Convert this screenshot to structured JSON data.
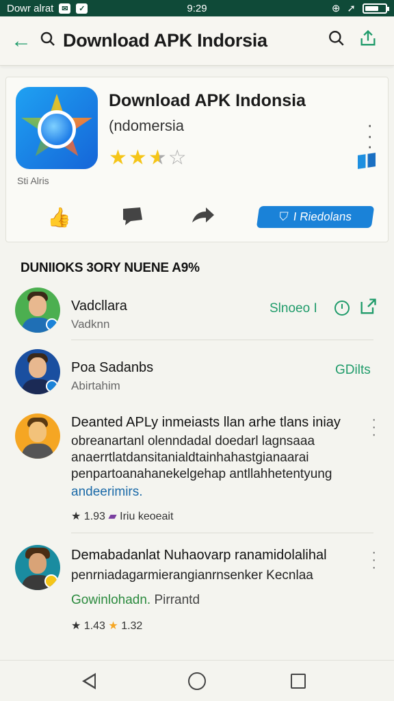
{
  "status_bar": {
    "left_text": "Dowr alrat",
    "time": "9:29"
  },
  "app_bar": {
    "back_icon": "arrow-left-icon",
    "title": "Download APK Indorsia"
  },
  "app_card": {
    "name": "Download APK Indonsia",
    "developer": "(ndomersia",
    "caption": "Sti Alris",
    "rating": 2.5,
    "rating_max": 5,
    "install_label": "I Riedolans"
  },
  "section": {
    "title": "DUNIIOKS 3ORY NUENE A9%"
  },
  "reviews": [
    {
      "name": "Vadcllara",
      "sub": "Vadknn",
      "action": "Slnoeo I",
      "avatar_bg": "#4caf50",
      "shirt": "#1f6fb5"
    },
    {
      "name": "Poa Sadanbs",
      "sub": "Abirtahim",
      "action": "GDilts",
      "avatar_bg": "#1a4fa0",
      "shirt": "#1b2a55"
    },
    {
      "title": "Deanted APLy inmeiasts llan arhe tlans iniay",
      "lines": [
        "obreanartanl olenndadal doedarl lagnsaaa",
        "anaerrtlatdansitanialdtainhahastgianaarai",
        "penpartoanahanekelgehap antllahhetentyung"
      ],
      "link": "andeerimirs.",
      "meta_rating": "1.93",
      "meta_text": "Iriu keoeait",
      "avatar_bg": "#f5a623"
    },
    {
      "title": "Demabadanlat Nuhaovarp ranamidolalihal",
      "line": "penrniadagarmierangianrnsenker Kecnlaa",
      "link_inline": "senker Kecnlaa",
      "green_text": "Gowinlohadn.",
      "green_suffix": "Pirrantd",
      "meta_rating": "1.43",
      "meta_text": "1.32",
      "avatar_bg": "#1a8ca0"
    }
  ]
}
